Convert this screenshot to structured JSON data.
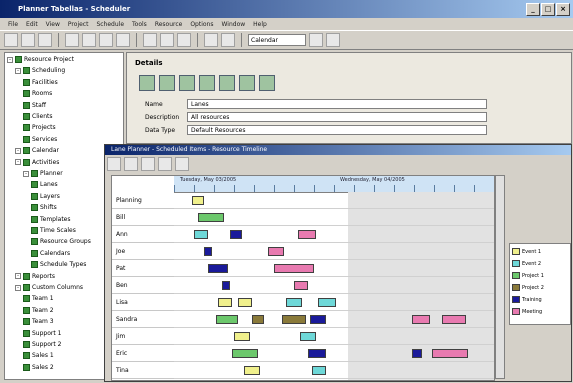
{
  "window": {
    "title": "Planner Tabellas - Scheduler"
  },
  "menu": [
    "File",
    "Edit",
    "View",
    "Project",
    "Schedule",
    "Tools",
    "Resource",
    "Options",
    "Window",
    "Help"
  ],
  "toolbar": {
    "combo_value": "Calendar"
  },
  "tree": {
    "items": [
      {
        "label": "Resource Project",
        "indent": 0,
        "kind": "root"
      },
      {
        "label": "Scheduling",
        "indent": 1,
        "kind": "folder"
      },
      {
        "label": "Facilities",
        "indent": 2,
        "kind": "item"
      },
      {
        "label": "Rooms",
        "indent": 2,
        "kind": "item"
      },
      {
        "label": "Staff",
        "indent": 2,
        "kind": "item"
      },
      {
        "label": "Clients",
        "indent": 2,
        "kind": "item"
      },
      {
        "label": "Projects",
        "indent": 2,
        "kind": "item"
      },
      {
        "label": "Services",
        "indent": 2,
        "kind": "item"
      },
      {
        "label": "Calendar",
        "indent": 1,
        "kind": "folder"
      },
      {
        "label": "Activities",
        "indent": 1,
        "kind": "folder"
      },
      {
        "label": "Planner",
        "indent": 2,
        "kind": "folder"
      },
      {
        "label": "Lanes",
        "indent": 3,
        "kind": "item"
      },
      {
        "label": "Layers",
        "indent": 3,
        "kind": "item"
      },
      {
        "label": "Shifts",
        "indent": 3,
        "kind": "item"
      },
      {
        "label": "Templates",
        "indent": 3,
        "kind": "item"
      },
      {
        "label": "Time Scales",
        "indent": 3,
        "kind": "item"
      },
      {
        "label": "Resource Groups",
        "indent": 3,
        "kind": "item"
      },
      {
        "label": "Calendars",
        "indent": 3,
        "kind": "item"
      },
      {
        "label": "Schedule Types",
        "indent": 3,
        "kind": "item"
      },
      {
        "label": "Reports",
        "indent": 1,
        "kind": "folder"
      },
      {
        "label": "Custom Columns",
        "indent": 1,
        "kind": "folder"
      },
      {
        "label": "Team 1",
        "indent": 2,
        "kind": "item"
      },
      {
        "label": "Team 2",
        "indent": 2,
        "kind": "item"
      },
      {
        "label": "Team 3",
        "indent": 2,
        "kind": "item"
      },
      {
        "label": "Support 1",
        "indent": 2,
        "kind": "item"
      },
      {
        "label": "Support 2",
        "indent": 2,
        "kind": "item"
      },
      {
        "label": "Sales 1",
        "indent": 2,
        "kind": "item"
      },
      {
        "label": "Sales 2",
        "indent": 2,
        "kind": "item"
      }
    ]
  },
  "properties": {
    "title": "Details",
    "fields": [
      {
        "label": "Name",
        "value": "Lanes"
      },
      {
        "label": "Description",
        "value": "All resources"
      },
      {
        "label": "Data Type",
        "value": "Default Resources"
      }
    ]
  },
  "planner": {
    "title": "Lane Planner - Scheduled Items - Resource Timeline",
    "days": [
      "Tuesday, May 03/2005",
      "Wednesday, May 04/2005"
    ],
    "rows": [
      "Planning",
      "Bill",
      "Ann",
      "Joe",
      "Pat",
      "Ben",
      "Lisa",
      "Sandra",
      "Jim",
      "Eric",
      "Tina"
    ],
    "legend": [
      {
        "label": "Event 1",
        "color": "#f0f08c"
      },
      {
        "label": "Event 2",
        "color": "#6ed8d8"
      },
      {
        "label": "Project 1",
        "color": "#6cc86c"
      },
      {
        "label": "Project 2",
        "color": "#8a7a3a"
      },
      {
        "label": "Training",
        "color": "#1a1a9a"
      },
      {
        "label": "Meeting",
        "color": "#e87ab0"
      }
    ]
  }
}
